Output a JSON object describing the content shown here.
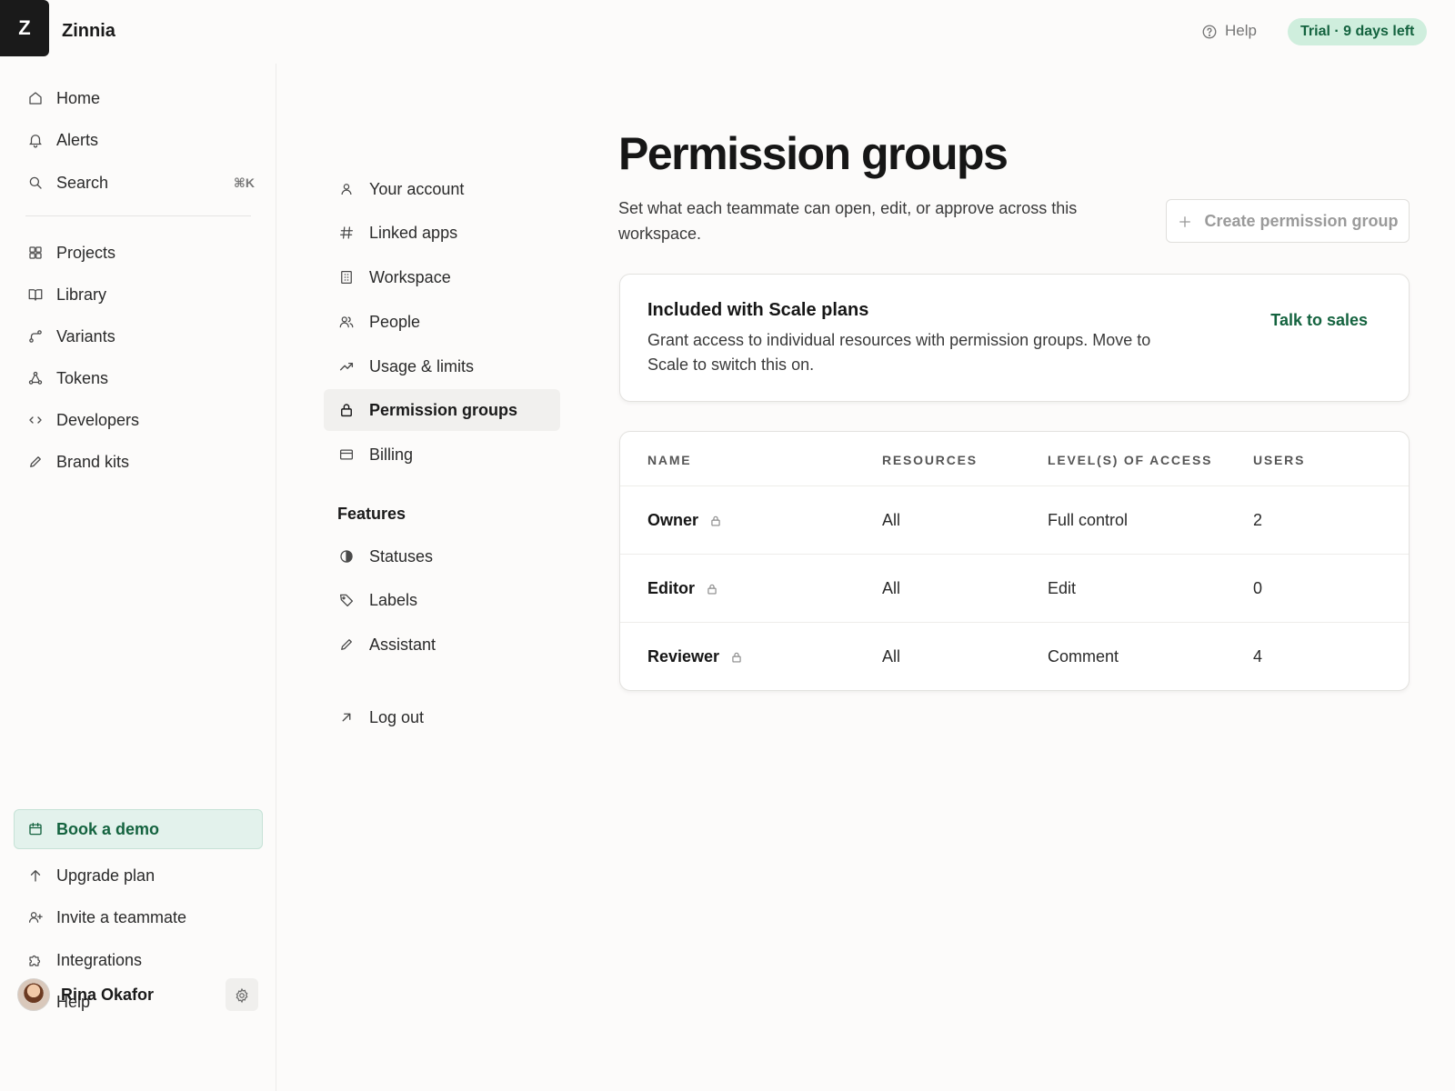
{
  "app": {
    "logo_letter": "Z",
    "name": "Zinnia"
  },
  "topbar": {
    "help_label": "Help",
    "trial_badge": "Trial · 9 days left"
  },
  "sidebar": {
    "items": [
      {
        "label": "Home",
        "icon": "home-icon"
      },
      {
        "label": "Alerts",
        "icon": "bell-icon"
      },
      {
        "label": "Search",
        "icon": "search-icon",
        "shortcut": "⌘K"
      },
      {
        "label": "Projects",
        "icon": "grid-icon"
      },
      {
        "label": "Library",
        "icon": "book-icon"
      },
      {
        "label": "Variants",
        "icon": "variants-icon"
      },
      {
        "label": "Tokens",
        "icon": "tokens-icon"
      },
      {
        "label": "Developers",
        "icon": "code-icon"
      },
      {
        "label": "Brand kits",
        "icon": "pencil-icon"
      }
    ],
    "book_demo": "Book a demo",
    "bottom_items": [
      {
        "label": "Upgrade plan",
        "icon": "arrow-up-icon"
      },
      {
        "label": "Invite a teammate",
        "icon": "user-plus-icon"
      },
      {
        "label": "Integrations",
        "icon": "puzzle-icon"
      },
      {
        "label": "Help",
        "icon": "help-circle-icon"
      }
    ],
    "user_name": "Rina Okafor"
  },
  "settings_nav": {
    "items": [
      {
        "label": "Your account",
        "icon": "user-icon"
      },
      {
        "label": "Linked apps",
        "icon": "hash-icon"
      },
      {
        "label": "Workspace",
        "icon": "building-icon"
      },
      {
        "label": "People",
        "icon": "people-icon"
      },
      {
        "label": "Usage & limits",
        "icon": "trend-icon"
      },
      {
        "label": "Permission groups",
        "icon": "lock-icon",
        "active": true
      },
      {
        "label": "Billing",
        "icon": "card-icon"
      }
    ],
    "features_heading": "Features",
    "features": [
      {
        "label": "Statuses",
        "icon": "half-circle-icon"
      },
      {
        "label": "Labels",
        "icon": "tag-icon"
      },
      {
        "label": "Assistant",
        "icon": "pencil-icon"
      }
    ],
    "logout": "Log out"
  },
  "main": {
    "title": "Permission groups",
    "description": "Set what each teammate can open, edit, or approve across this workspace.",
    "create_button": "Create permission group",
    "upsell": {
      "title": "Included with Scale plans",
      "body": "Grant access to individual resources with permission groups. Move to Scale to switch this on.",
      "cta": "Talk to sales"
    },
    "table": {
      "columns": [
        "NAME",
        "RESOURCES",
        "LEVEL(S) OF ACCESS",
        "USERS"
      ],
      "rows": [
        {
          "name": "Owner",
          "resources": "All",
          "access": "Full control",
          "users": "2"
        },
        {
          "name": "Editor",
          "resources": "All",
          "access": "Edit",
          "users": "0"
        },
        {
          "name": "Reviewer",
          "resources": "All",
          "access": "Comment",
          "users": "4"
        }
      ]
    }
  }
}
